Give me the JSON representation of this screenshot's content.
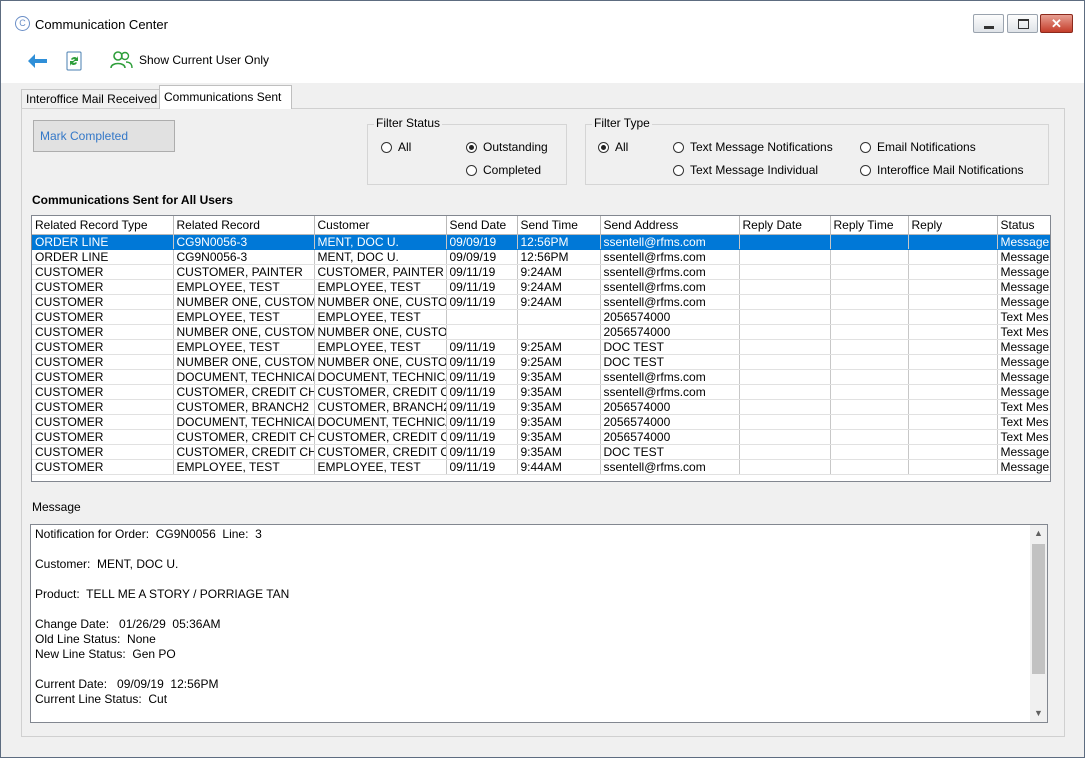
{
  "window": {
    "title": "Communication Center"
  },
  "toolbar": {
    "show_current_user_label": "Show Current User Only"
  },
  "tabs": [
    {
      "label": "Interoffice Mail Received"
    },
    {
      "label": "Communications Sent"
    }
  ],
  "actions": {
    "mark_completed": "Mark Completed"
  },
  "filter_status": {
    "title": "Filter Status",
    "options": [
      {
        "label": "All"
      },
      {
        "label": "Outstanding"
      },
      {
        "label": "Completed"
      }
    ],
    "selected": "Outstanding"
  },
  "filter_type": {
    "title": "Filter Type",
    "options": [
      {
        "label": "All"
      },
      {
        "label": "Text Message Notifications"
      },
      {
        "label": "Email Notifications"
      },
      {
        "label": "Text Message Individual"
      },
      {
        "label": "Interoffice Mail Notifications"
      }
    ],
    "selected": "All"
  },
  "grid": {
    "title": "Communications Sent for All Users",
    "columns": [
      "Related Record Type",
      "Related Record",
      "Customer",
      "Send Date",
      "Send Time",
      "Send Address",
      "Reply Date",
      "Reply Time",
      "Reply",
      "Status"
    ],
    "rows": [
      [
        "ORDER LINE",
        "CG9N0056-3",
        "MENT, DOC U.",
        "09/09/19",
        "12:56PM",
        "ssentell@rfms.com",
        "",
        "",
        "",
        "Message"
      ],
      [
        "ORDER LINE",
        "CG9N0056-3",
        "MENT, DOC U.",
        "09/09/19",
        "12:56PM",
        "ssentell@rfms.com",
        "",
        "",
        "",
        "Message"
      ],
      [
        "CUSTOMER",
        "CUSTOMER, PAINTER",
        "CUSTOMER, PAINTER",
        "09/11/19",
        "9:24AM",
        "ssentell@rfms.com",
        "",
        "",
        "",
        "Message"
      ],
      [
        "CUSTOMER",
        "EMPLOYEE, TEST",
        "EMPLOYEE, TEST",
        "09/11/19",
        "9:24AM",
        "ssentell@rfms.com",
        "",
        "",
        "",
        "Message"
      ],
      [
        "CUSTOMER",
        "NUMBER ONE, CUSTOME",
        "NUMBER ONE, CUSTOM",
        "09/11/19",
        "9:24AM",
        "ssentell@rfms.com",
        "",
        "",
        "",
        "Message"
      ],
      [
        "CUSTOMER",
        "EMPLOYEE, TEST",
        "EMPLOYEE, TEST",
        "",
        "",
        "2056574000",
        "",
        "",
        "",
        "Text Mes"
      ],
      [
        "CUSTOMER",
        "NUMBER ONE, CUSTOME",
        "NUMBER ONE, CUSTOM",
        "",
        "",
        "2056574000",
        "",
        "",
        "",
        "Text Mes"
      ],
      [
        "CUSTOMER",
        "EMPLOYEE, TEST",
        "EMPLOYEE, TEST",
        "09/11/19",
        "9:25AM",
        "DOC TEST",
        "",
        "",
        "",
        "Message"
      ],
      [
        "CUSTOMER",
        "NUMBER ONE, CUSTOME",
        "NUMBER ONE, CUSTOM",
        "09/11/19",
        "9:25AM",
        "DOC TEST",
        "",
        "",
        "",
        "Message"
      ],
      [
        "CUSTOMER",
        "DOCUMENT, TECHNICAL",
        "DOCUMENT, TECHNICA",
        "09/11/19",
        "9:35AM",
        "ssentell@rfms.com",
        "",
        "",
        "",
        "Message"
      ],
      [
        "CUSTOMER",
        "CUSTOMER, CREDIT CHE",
        "CUSTOMER, CREDIT CHI",
        "09/11/19",
        "9:35AM",
        "ssentell@rfms.com",
        "",
        "",
        "",
        "Message"
      ],
      [
        "CUSTOMER",
        "CUSTOMER, BRANCH2",
        "CUSTOMER, BRANCH2",
        "09/11/19",
        "9:35AM",
        "2056574000",
        "",
        "",
        "",
        "Text Mes"
      ],
      [
        "CUSTOMER",
        "DOCUMENT, TECHNICAL",
        "DOCUMENT, TECHNICA",
        "09/11/19",
        "9:35AM",
        "2056574000",
        "",
        "",
        "",
        "Text Mes"
      ],
      [
        "CUSTOMER",
        "CUSTOMER, CREDIT CHE",
        "CUSTOMER, CREDIT CHI",
        "09/11/19",
        "9:35AM",
        "2056574000",
        "",
        "",
        "",
        "Text Mes"
      ],
      [
        "CUSTOMER",
        "CUSTOMER, CREDIT CHE",
        "CUSTOMER, CREDIT CHI",
        "09/11/19",
        "9:35AM",
        "DOC TEST",
        "",
        "",
        "",
        "Message"
      ],
      [
        "CUSTOMER",
        "EMPLOYEE, TEST",
        "EMPLOYEE, TEST",
        "09/11/19",
        "9:44AM",
        "ssentell@rfms.com",
        "",
        "",
        "",
        "Message"
      ]
    ],
    "selected_row": 0
  },
  "message": {
    "label": "Message",
    "lines": [
      "Notification for Order:  CG9N0056  Line:  3",
      "",
      "Customer:  MENT, DOC U.",
      "",
      "Product:  TELL ME A STORY / PORRIAGE TAN",
      "",
      "Change Date:   01/26/29  05:36AM",
      "Old Line Status:  None",
      "New Line Status:  Gen PO",
      "",
      "Current Date:   09/09/19  12:56PM",
      "Current Line Status:  Cut"
    ]
  },
  "colors": {
    "accent": "#0078d7",
    "link_text": "#3478c8",
    "close_button": "#c43d2a"
  }
}
